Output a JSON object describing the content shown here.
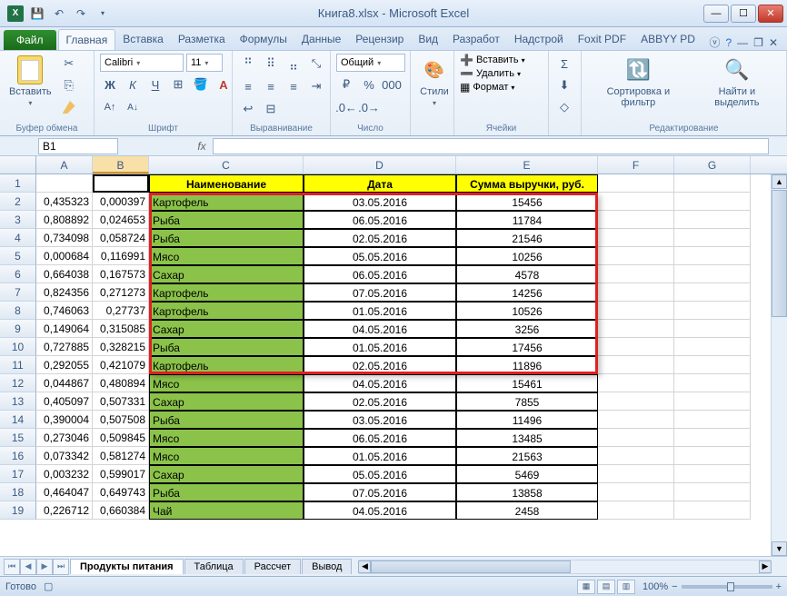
{
  "title": "Книга8.xlsx - Microsoft Excel",
  "file_tab": "Файл",
  "tabs": [
    "Главная",
    "Вставка",
    "Разметка",
    "Формулы",
    "Данные",
    "Рецензир",
    "Вид",
    "Разработ",
    "Надстрой",
    "Foxit PDF",
    "ABBYY PD"
  ],
  "active_tab": 0,
  "groups": {
    "clipboard": {
      "label": "Буфер обмена",
      "paste": "Вставить"
    },
    "font": {
      "label": "Шрифт",
      "name": "Calibri",
      "size": "11"
    },
    "align": {
      "label": "Выравнивание"
    },
    "number": {
      "label": "Число",
      "format": "Общий"
    },
    "styles": {
      "label": "",
      "btn": "Стили"
    },
    "cells": {
      "label": "Ячейки",
      "insert": "Вставить",
      "delete": "Удалить",
      "format": "Формат"
    },
    "editing": {
      "label": "Редактирование",
      "sort": "Сортировка и фильтр",
      "find": "Найти и выделить"
    }
  },
  "name_box": "B1",
  "columns": [
    "A",
    "B",
    "C",
    "D",
    "E",
    "F",
    "G"
  ],
  "selected_col": "B",
  "selected_cell": {
    "row": 1,
    "col": "B"
  },
  "header_row": {
    "C": "Наименование",
    "D": "Дата",
    "E": "Сумма выручки, руб."
  },
  "data_rows": [
    {
      "r": 2,
      "A": "0,435323",
      "B": "0,000397",
      "C": "Картофель",
      "D": "03.05.2016",
      "E": "15456"
    },
    {
      "r": 3,
      "A": "0,808892",
      "B": "0,024653",
      "C": "Рыба",
      "D": "06.05.2016",
      "E": "11784"
    },
    {
      "r": 4,
      "A": "0,734098",
      "B": "0,058724",
      "C": "Рыба",
      "D": "02.05.2016",
      "E": "21546"
    },
    {
      "r": 5,
      "A": "0,000684",
      "B": "0,116991",
      "C": "Мясо",
      "D": "05.05.2016",
      "E": "10256"
    },
    {
      "r": 6,
      "A": "0,664038",
      "B": "0,167573",
      "C": "Сахар",
      "D": "06.05.2016",
      "E": "4578"
    },
    {
      "r": 7,
      "A": "0,824356",
      "B": "0,271273",
      "C": "Картофель",
      "D": "07.05.2016",
      "E": "14256"
    },
    {
      "r": 8,
      "A": "0,746063",
      "B": "0,27737",
      "C": "Картофель",
      "D": "01.05.2016",
      "E": "10526"
    },
    {
      "r": 9,
      "A": "0,149064",
      "B": "0,315085",
      "C": "Сахар",
      "D": "04.05.2016",
      "E": "3256"
    },
    {
      "r": 10,
      "A": "0,727885",
      "B": "0,328215",
      "C": "Рыба",
      "D": "01.05.2016",
      "E": "17456"
    },
    {
      "r": 11,
      "A": "0,292055",
      "B": "0,421079",
      "C": "Картофель",
      "D": "02.05.2016",
      "E": "11896"
    },
    {
      "r": 12,
      "A": "0,044867",
      "B": "0,480894",
      "C": "Мясо",
      "D": "04.05.2016",
      "E": "15461"
    },
    {
      "r": 13,
      "A": "0,405097",
      "B": "0,507331",
      "C": "Сахар",
      "D": "02.05.2016",
      "E": "7855"
    },
    {
      "r": 14,
      "A": "0,390004",
      "B": "0,507508",
      "C": "Рыба",
      "D": "03.05.2016",
      "E": "11496"
    },
    {
      "r": 15,
      "A": "0,273046",
      "B": "0,509845",
      "C": "Мясо",
      "D": "06.05.2016",
      "E": "13485"
    },
    {
      "r": 16,
      "A": "0,073342",
      "B": "0,581274",
      "C": "Мясо",
      "D": "01.05.2016",
      "E": "21563"
    },
    {
      "r": 17,
      "A": "0,003232",
      "B": "0,599017",
      "C": "Сахар",
      "D": "05.05.2016",
      "E": "5469"
    },
    {
      "r": 18,
      "A": "0,464047",
      "B": "0,649743",
      "C": "Рыба",
      "D": "07.05.2016",
      "E": "13858"
    },
    {
      "r": 19,
      "A": "0,226712",
      "B": "0,660384",
      "C": "Чай",
      "D": "04.05.2016",
      "E": "2458"
    }
  ],
  "sheets": [
    "Продукты питания",
    "Таблица",
    "Рассчет",
    "Вывод"
  ],
  "active_sheet": 0,
  "status": "Готово",
  "zoom": "100%",
  "highlight_rows": {
    "from": 2,
    "to": 11
  },
  "chart_data": null
}
